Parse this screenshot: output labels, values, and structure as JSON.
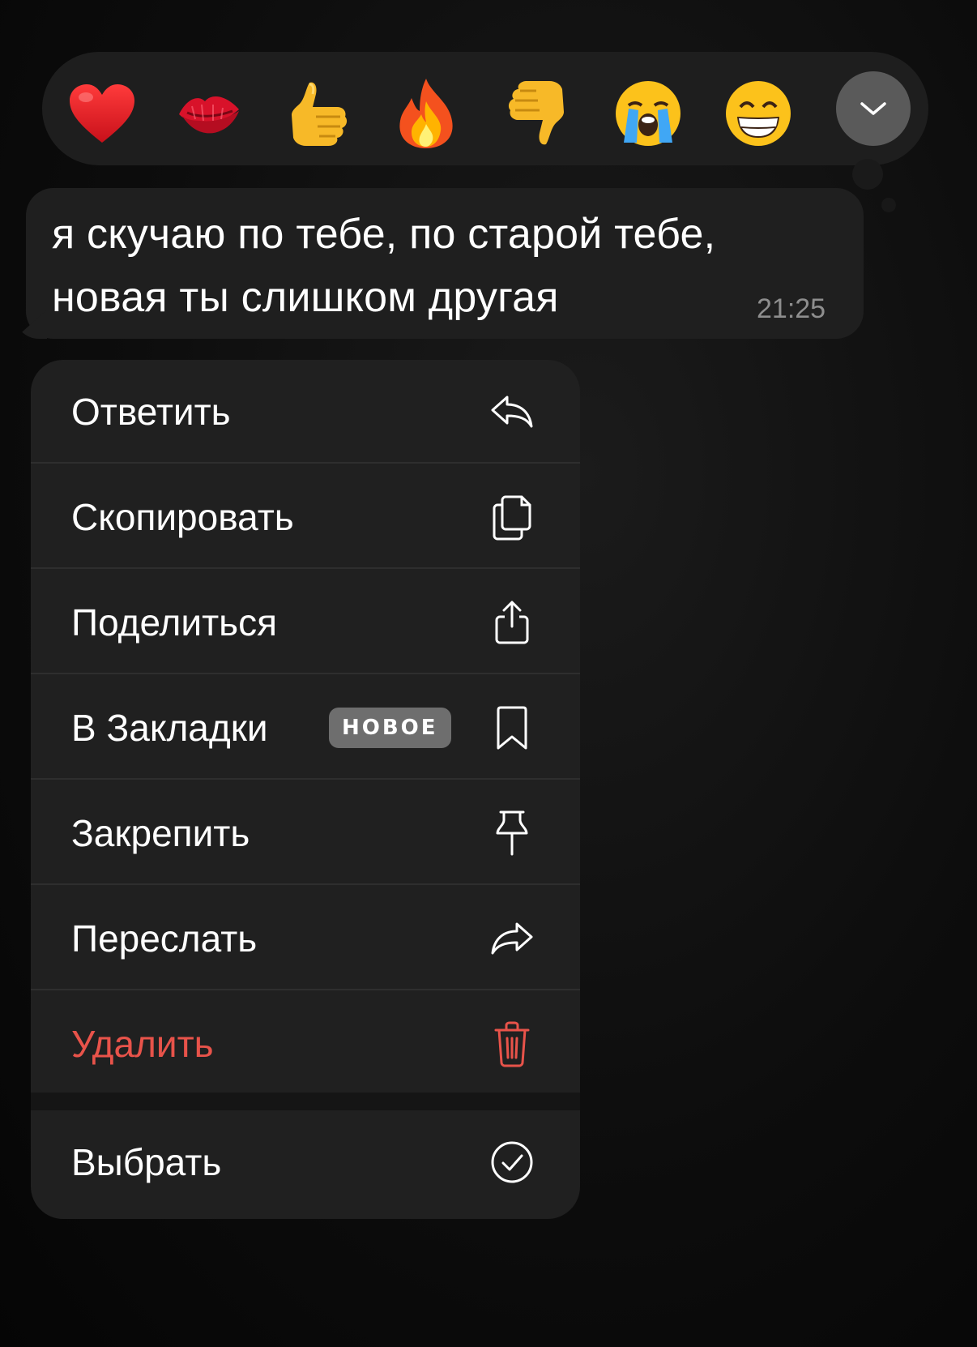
{
  "reactions": [
    {
      "name": "red-heart",
      "emoji": "❤️"
    },
    {
      "name": "kiss-mark",
      "emoji": "💋"
    },
    {
      "name": "thumbs-up",
      "emoji": "👍"
    },
    {
      "name": "fire",
      "emoji": "🔥"
    },
    {
      "name": "thumbs-down",
      "emoji": "👎"
    },
    {
      "name": "loudly-crying-face",
      "emoji": "😭"
    },
    {
      "name": "beaming-face",
      "emoji": "😁"
    }
  ],
  "expand_icon": "chevron-down-icon",
  "message": {
    "text": "я скучаю по тебе, по старой тебе,\nновая ты слишком другая",
    "time": "21:25"
  },
  "menu": {
    "reply": {
      "label": "Ответить",
      "icon": "reply-icon"
    },
    "copy": {
      "label": "Скопировать",
      "icon": "copy-icon"
    },
    "share": {
      "label": "Поделиться",
      "icon": "share-icon"
    },
    "bookmark": {
      "label": "В Закладки",
      "badge": "НОВОЕ",
      "icon": "bookmark-icon"
    },
    "pin": {
      "label": "Закрепить",
      "icon": "pin-icon"
    },
    "forward": {
      "label": "Переслать",
      "icon": "forward-icon"
    },
    "delete": {
      "label": "Удалить",
      "icon": "trash-icon"
    },
    "select": {
      "label": "Выбрать",
      "icon": "check-circle-icon"
    }
  },
  "colors": {
    "danger": "#e8534a",
    "menu_background": "#202020",
    "bubble_background": "#1f1f1f"
  }
}
